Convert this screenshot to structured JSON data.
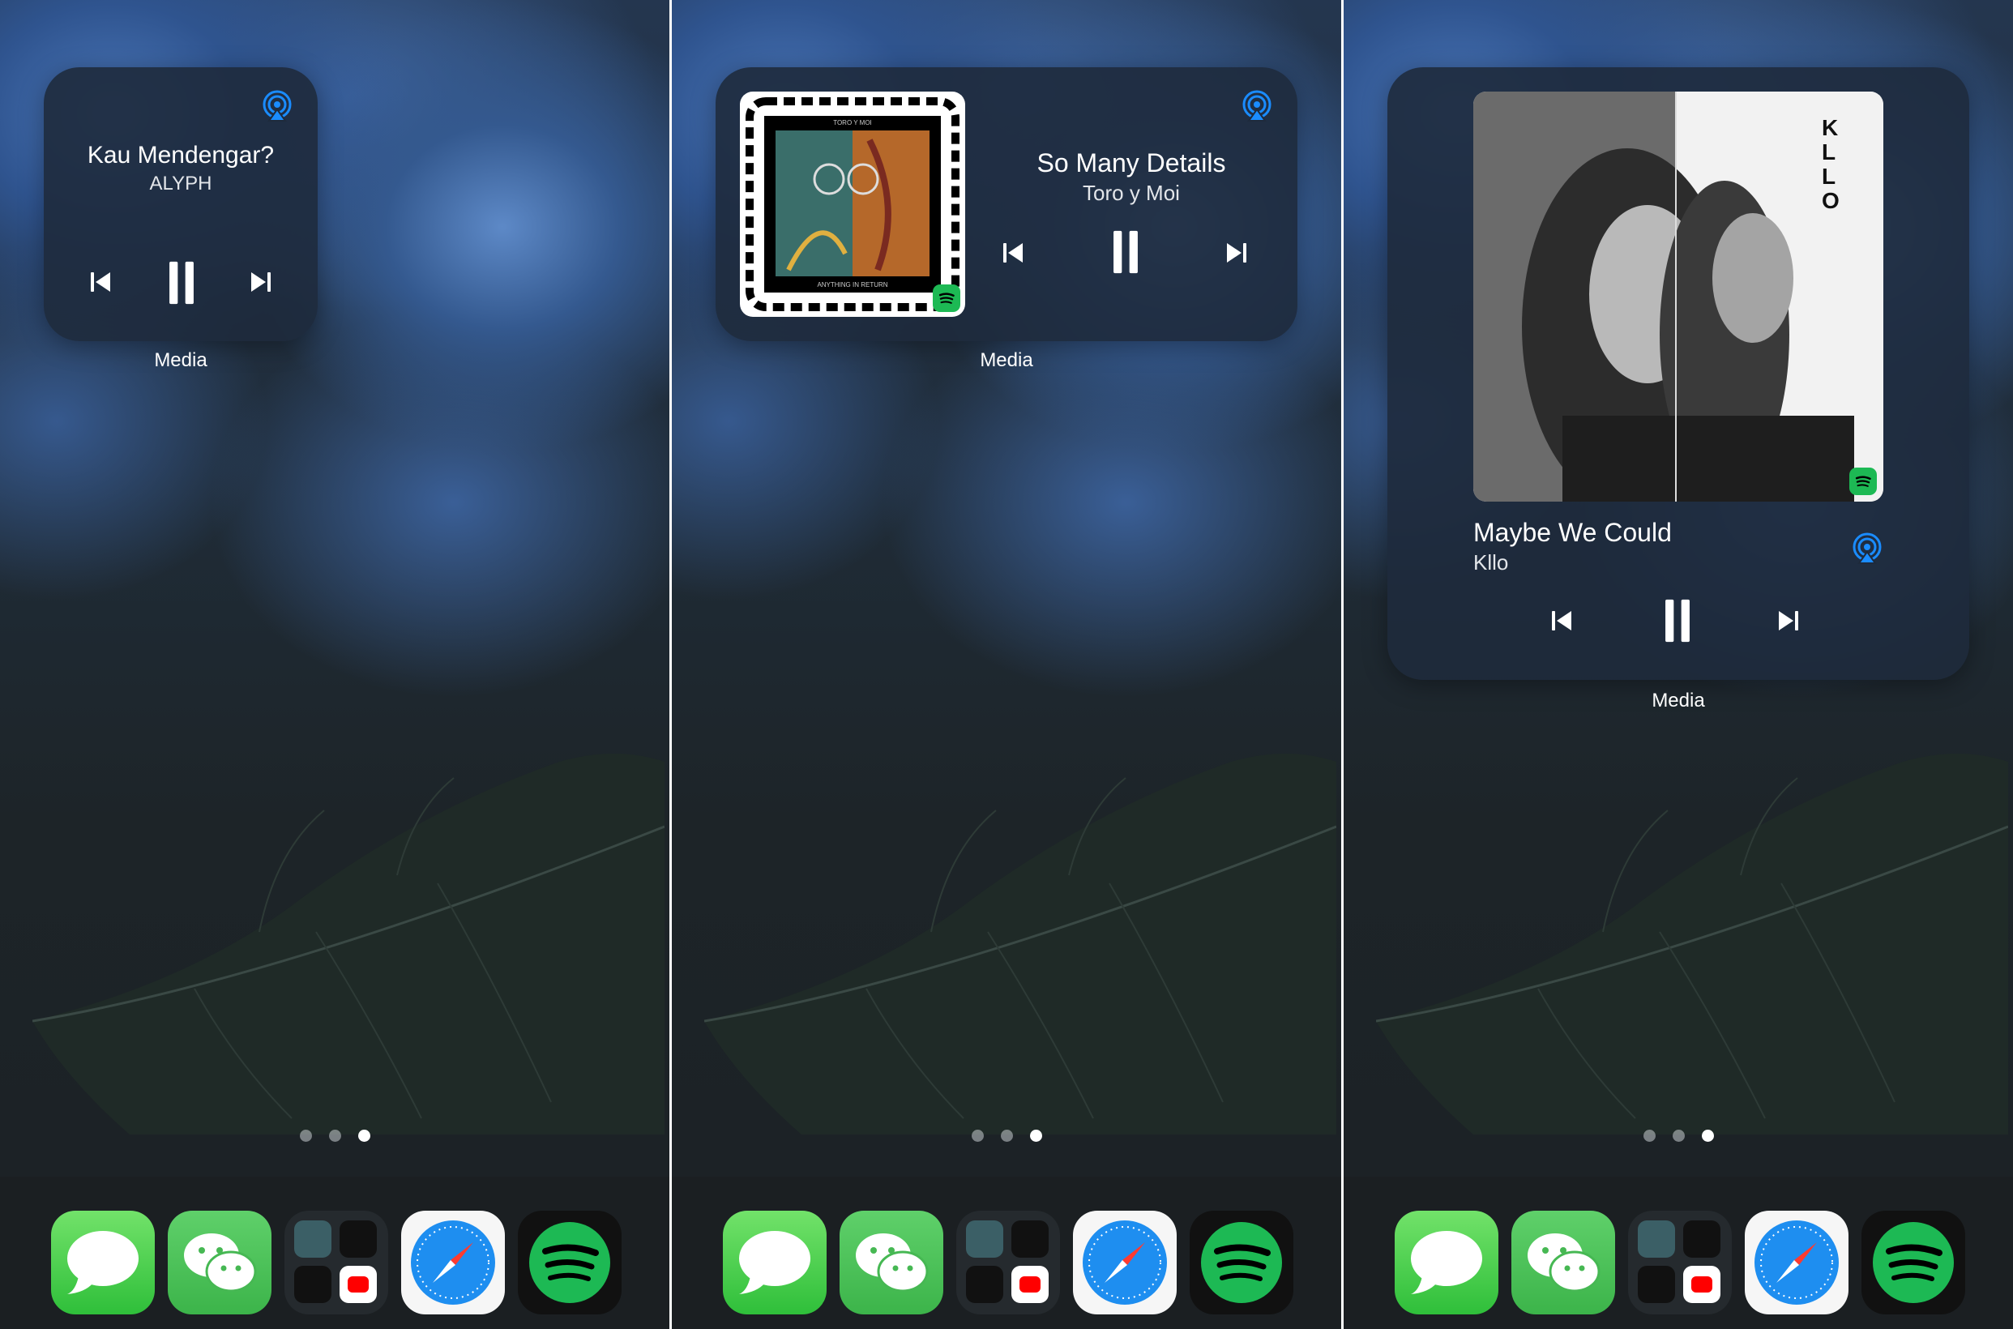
{
  "panels": [
    {
      "widget": {
        "title": "Kau Mendengar?",
        "artist": "ALYPH",
        "label": "Media"
      },
      "page_dots": {
        "count": 3,
        "active": 3
      }
    },
    {
      "widget": {
        "title": "So Many Details",
        "artist": "Toro y Moi",
        "label": "Media",
        "album_text_top": "TORO Y MOI",
        "album_text_bottom": "ANYTHING IN RETURN"
      },
      "page_dots": {
        "count": 3,
        "active": 3
      }
    },
    {
      "widget": {
        "title": "Maybe We Could",
        "artist": "Kllo",
        "label": "Media",
        "album_text": "KLLO"
      },
      "page_dots": {
        "count": 3,
        "active": 3
      }
    }
  ],
  "dock": {
    "apps": [
      "messages-app",
      "wechat-app",
      "app-folder",
      "safari-app",
      "spotify-app"
    ]
  },
  "colors": {
    "airplay": "#1a8cff",
    "spotify_green": "#1db954",
    "widget_bg": "#1e2a3c"
  },
  "icons": [
    "previous-track-icon",
    "pause-icon",
    "next-track-icon",
    "airplay-icon",
    "spotify-icon"
  ]
}
